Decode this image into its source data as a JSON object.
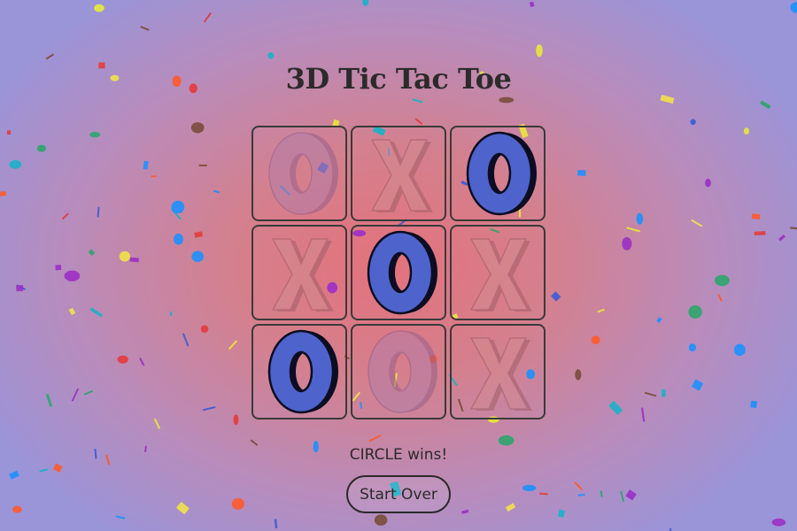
{
  "title": "3D Tic Tac Toe",
  "board": [
    "O",
    "X",
    "O",
    "X",
    "O",
    "X",
    "O",
    "O",
    "X"
  ],
  "winning_cells": [
    2,
    4,
    6
  ],
  "status": "CIRCLE wins!",
  "restart_label": "Start Over",
  "colors": {
    "o_win_fill": "#4f63cc",
    "o_win_edge": "#0c0c22",
    "o_faded_fill": "#b27ea8",
    "o_faded_edge": "#94608a",
    "x_faded_fill": "#d38a90",
    "x_faded_edge": "#a05e68"
  },
  "confetti_palette": [
    "#1e90ff",
    "#e33b3b",
    "#9b2fc7",
    "#f2e24a",
    "#2ea56b",
    "#ff5a2a",
    "#17b3c9",
    "#e8e83a",
    "#3b5bd6",
    "#7a4d3a"
  ]
}
